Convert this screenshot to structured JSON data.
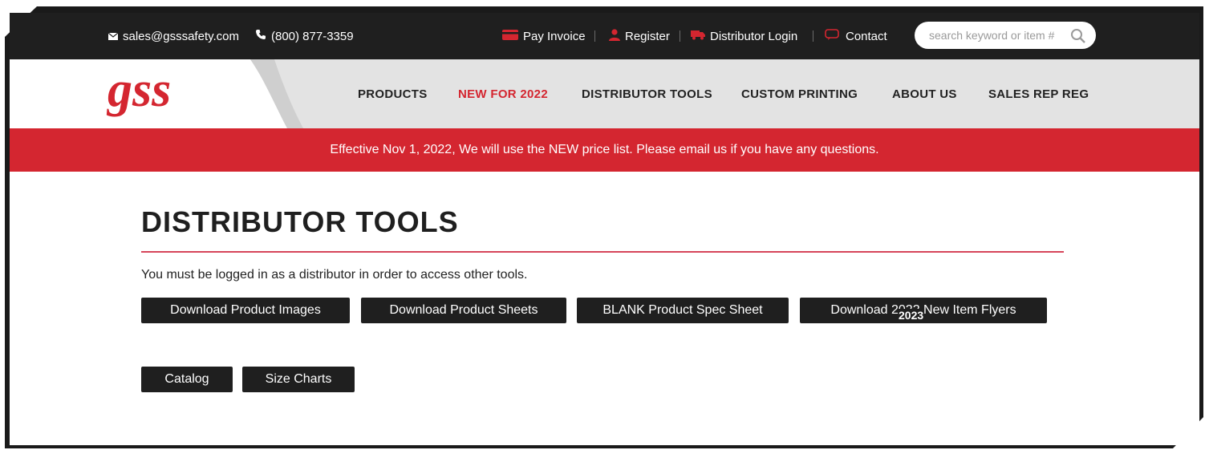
{
  "topbar": {
    "email": "sales@gsssafety.com",
    "phone": "(800) 877-3359",
    "links": [
      "Pay Invoice",
      "Register",
      "Distributor Login",
      "Contact"
    ],
    "search_placeholder": "search keyword or item #"
  },
  "brand": {
    "logo_text": "gss",
    "red": "#d42630",
    "dark": "#1f1f1f"
  },
  "nav": {
    "items": [
      "PRODUCTS",
      "NEW FOR 2022",
      "DISTRIBUTOR TOOLS",
      "CUSTOM PRINTING",
      "ABOUT US",
      "SALES REP REG"
    ],
    "active_index": 1
  },
  "announcement": "Effective Nov 1, 2022, We will use the NEW price list. Please email us if you have any questions.",
  "main": {
    "title": "DISTRIBUTOR TOOLS",
    "note": "You must be logged in as a distributor in order to access other tools.",
    "buttons": [
      "Download Product Images",
      "Download Product Sheets",
      "BLANK Product Spec Sheet",
      "Download 2022 New Item Flyers",
      "Catalog",
      "Size Charts"
    ],
    "overlay_year": "2023"
  }
}
